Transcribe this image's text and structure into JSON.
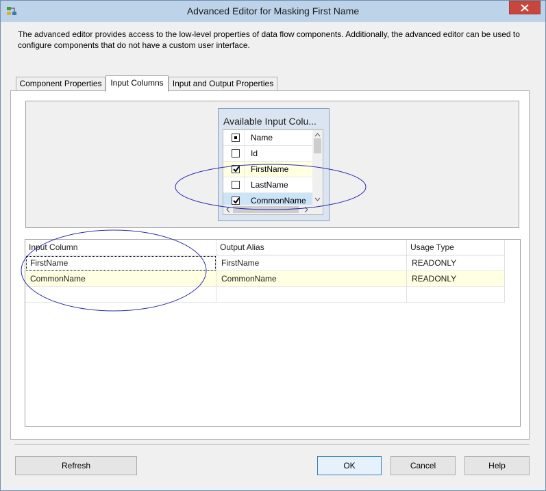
{
  "window": {
    "title": "Advanced Editor for Masking First Name"
  },
  "description": "The advanced editor provides access to the low-level properties of data flow components. Additionally, the advanced editor can be used to configure components that do not have a custom user interface.",
  "tabs": [
    {
      "label": "Component Properties",
      "active": false
    },
    {
      "label": "Input Columns",
      "active": true
    },
    {
      "label": "Input and Output Properties",
      "active": false
    }
  ],
  "available_columns": {
    "title": "Available Input Colu...",
    "header": "Name",
    "rows": [
      {
        "label": "Id",
        "checked": false
      },
      {
        "label": "FirstName",
        "checked": true
      },
      {
        "label": "LastName",
        "checked": false
      },
      {
        "label": "CommonName",
        "checked": true
      }
    ]
  },
  "grid": {
    "headers": [
      "Input Column",
      "Output Alias",
      "Usage Type"
    ],
    "rows": [
      {
        "input": "FirstName",
        "alias": "FirstName",
        "usage": "READONLY"
      },
      {
        "input": "CommonName",
        "alias": "CommonName",
        "usage": "READONLY"
      }
    ]
  },
  "buttons": {
    "refresh": "Refresh",
    "ok": "OK",
    "cancel": "Cancel",
    "help": "Help"
  },
  "colors": {
    "titlebar": "#bdd3ea",
    "close": "#c7473d",
    "highlight_row": "#ffffe1",
    "selected_row": "#cce4f7",
    "annotation": "#2a2ab0"
  }
}
